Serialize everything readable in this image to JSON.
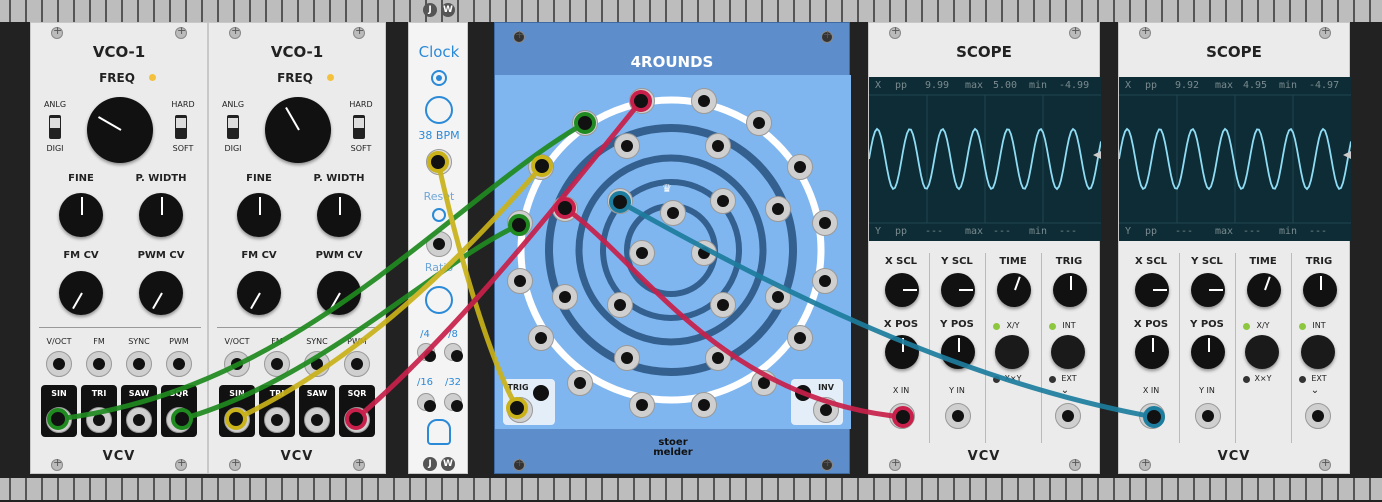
{
  "vco1": {
    "title": "VCO-1",
    "freq": "FREQ",
    "anlg": "ANLG",
    "digi": "DIGI",
    "hard": "HARD",
    "soft": "SOFT",
    "fine": "FINE",
    "pwidth": "P. WIDTH",
    "fmcv": "FM CV",
    "pwmcv": "PWM CV",
    "voct": "V/OCT",
    "fm": "FM",
    "sync": "SYNC",
    "pwm": "PWM",
    "sin": "SIN",
    "tri": "TRI",
    "saw": "SAW",
    "sqr": "SQR",
    "brand": "VCV"
  },
  "vco2": {
    "title": "VCO-1",
    "freq": "FREQ",
    "anlg": "ANLG",
    "digi": "DIGI",
    "hard": "HARD",
    "soft": "SOFT",
    "fine": "FINE",
    "pwidth": "P. WIDTH",
    "fmcv": "FM CV",
    "pwmcv": "PWM CV",
    "voct": "V/OCT",
    "fm": "FM",
    "sync": "SYNC",
    "pwm": "PWM",
    "sin": "SIN",
    "tri": "TRI",
    "saw": "SAW",
    "sqr": "SQR",
    "brand": "VCV"
  },
  "clock": {
    "badge1": "J",
    "badge2": "W",
    "title": "Clock",
    "bpm": "38 BPM",
    "reset": "Reset",
    "ratio": "Ratio",
    "div4": "/4",
    "div8": "/8",
    "div16": "/16",
    "div32": "/32"
  },
  "rounds": {
    "title": "4ROUNDS",
    "trig": "TRIG",
    "inv": "INV",
    "brand1": "stoer",
    "brand2": "melder"
  },
  "scope1": {
    "title": "SCOPE",
    "xs": "X",
    "pp": "pp",
    "ppv": "9.99",
    "max": "max",
    "maxv": "5.00",
    "min": "min",
    "minv": "-4.99",
    "ys": "Y",
    "ypp": "pp",
    "yppv": "---",
    "ymax": "max",
    "ymaxv": "---",
    "ymin": "min",
    "yminv": "---",
    "xscl": "X SCL",
    "yscl": "Y SCL",
    "time": "TIME",
    "trig": "TRIG",
    "xpos": "X POS",
    "ypos": "Y POS",
    "xy": "X/Y",
    "xxy": "X×Y",
    "int": "INT",
    "ext": "EXT",
    "xin": "X IN",
    "yin": "Y IN",
    "brand": "VCV"
  },
  "scope2": {
    "title": "SCOPE",
    "xs": "X",
    "pp": "pp",
    "ppv": "9.92",
    "max": "max",
    "maxv": "4.95",
    "min": "min",
    "minv": "-4.97",
    "ys": "Y",
    "ypp": "pp",
    "yppv": "---",
    "ymax": "max",
    "ymaxv": "---",
    "ymin": "min",
    "yminv": "---",
    "xscl": "X SCL",
    "yscl": "Y SCL",
    "time": "TIME",
    "trig": "TRIG",
    "xpos": "X POS",
    "ypos": "Y POS",
    "xy": "X/Y",
    "xxy": "X×Y",
    "int": "INT",
    "ext": "EXT",
    "xin": "X IN",
    "yin": "Y IN",
    "brand": "VCV"
  },
  "colors": {
    "cable_green": "#1f8a1f",
    "cable_yellow": "#c9b21a",
    "cable_red": "#c8204a",
    "cable_blue": "#1d7d9e",
    "rounds_bg": "#7fb6f0",
    "clock_accent": "#2b8ad8"
  }
}
